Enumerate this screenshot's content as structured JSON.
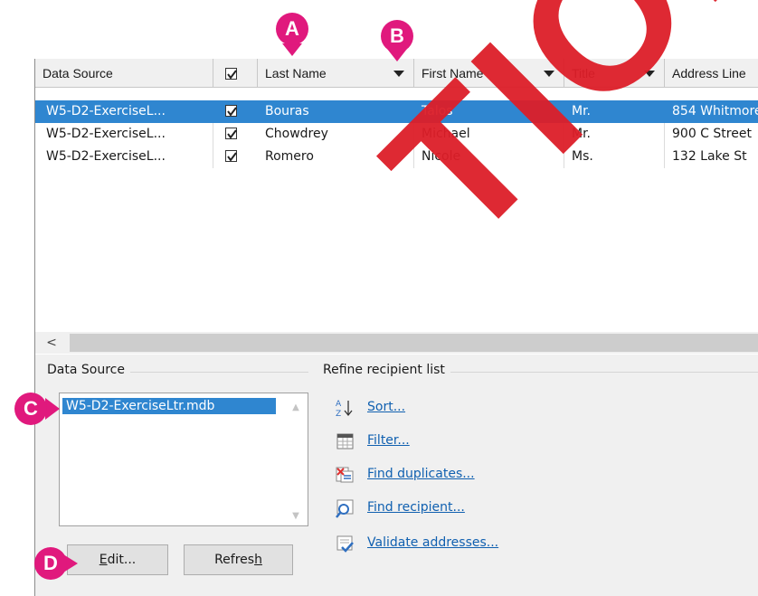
{
  "grid": {
    "columns": [
      {
        "label": "Data Source",
        "dropdown": false
      },
      {
        "label": "",
        "dropdown": false,
        "checkbox": true
      },
      {
        "label": "Last Name",
        "dropdown": true
      },
      {
        "label": "First Name",
        "dropdown": true
      },
      {
        "label": "Title",
        "dropdown": true
      },
      {
        "label": "Address Line",
        "dropdown": false
      }
    ],
    "rows": [
      {
        "source": "W5-D2-ExerciseL...",
        "checked": true,
        "last": "Bouras",
        "first": "Talos",
        "title": "Mr.",
        "address": "854 Whitmore",
        "selected": true
      },
      {
        "source": "W5-D2-ExerciseL...",
        "checked": true,
        "last": "Chowdrey",
        "first": "Michael",
        "title": "Mr.",
        "address": "900 C Street",
        "selected": false
      },
      {
        "source": "W5-D2-ExerciseL...",
        "checked": true,
        "last": "Romero",
        "first": "Nicole",
        "title": "Ms.",
        "address": "132 Lake St",
        "selected": false
      }
    ],
    "scroll_left_glyph": "<"
  },
  "data_source_panel": {
    "label": "Data Source",
    "items": [
      "W5-D2-ExerciseLtr.mdb"
    ],
    "edit_button": "Edit...",
    "edit_underline": "E",
    "edit_rest": "dit...",
    "refresh_button": "Refresh",
    "refresh_pre": "Refres",
    "refresh_underline": "h"
  },
  "refine_panel": {
    "label": "Refine recipient list",
    "items": [
      {
        "label": "Sort...",
        "icon": "sort-az-icon"
      },
      {
        "label": "Filter...",
        "icon": "filter-icon"
      },
      {
        "label": "Find duplicates...",
        "icon": "find-duplicates-icon"
      },
      {
        "label": "Find recipient...",
        "icon": "find-recipient-icon"
      },
      {
        "label": "Validate addresses...",
        "icon": "validate-addresses-icon"
      }
    ]
  },
  "callouts": [
    "A",
    "B",
    "C",
    "D"
  ],
  "watermark": "TION C",
  "colors": {
    "selection": "#2f86d0",
    "callout": "#e0197d",
    "watermark": "#dc1e28",
    "link": "#1060b0"
  }
}
